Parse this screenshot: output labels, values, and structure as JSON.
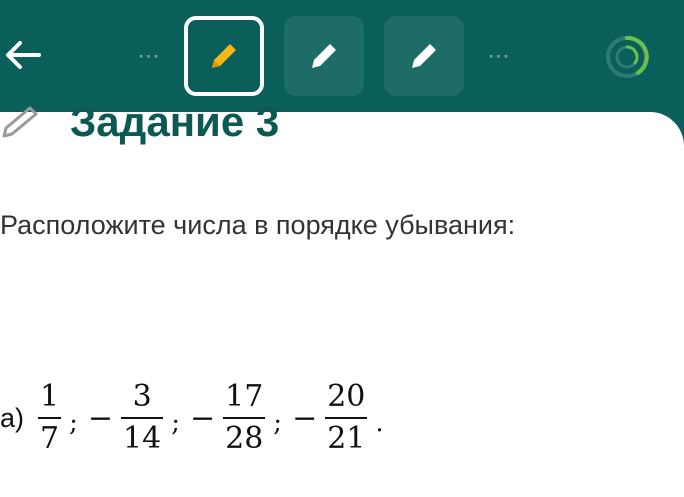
{
  "toolbar": {
    "dots_left": "⋯",
    "dots_right": "⋯",
    "colors": {
      "bar_bg": "#0b5f5a",
      "tool_bg": "#1e6c68",
      "active_pencil": "#f3b71a",
      "progress_ring": "#6cc04a"
    },
    "icons": [
      "back-arrow-icon",
      "pencil-icon",
      "progress-ring-icon"
    ]
  },
  "task": {
    "title": "Задание 3",
    "instruction": "Расположите числа в порядке убывания:",
    "item_label": "а)",
    "separator": ";",
    "minus": "−",
    "end": ".",
    "fractions": [
      {
        "sign": "",
        "num": "1",
        "den": "7"
      },
      {
        "sign": "−",
        "num": "3",
        "den": "14"
      },
      {
        "sign": "−",
        "num": "17",
        "den": "28"
      },
      {
        "sign": "−",
        "num": "20",
        "den": "21"
      }
    ]
  }
}
